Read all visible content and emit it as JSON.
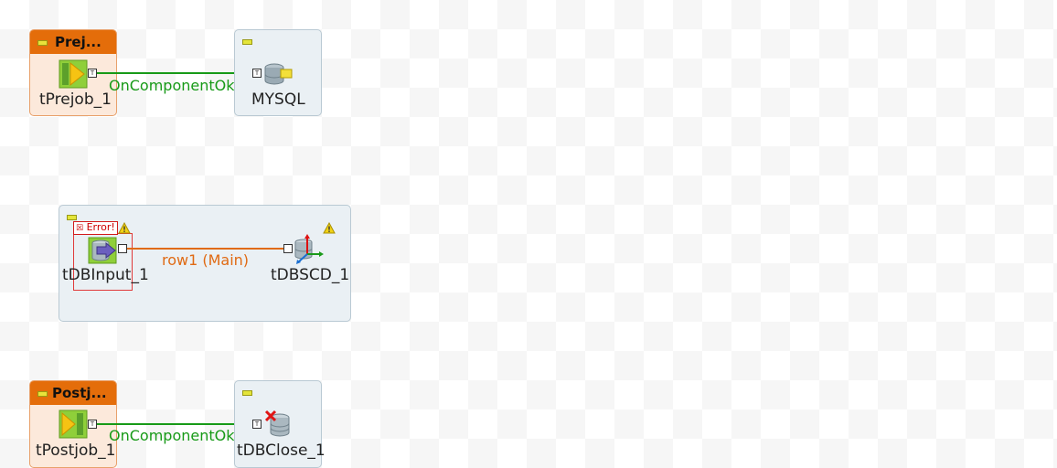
{
  "prejob": {
    "title": "Prej...",
    "component_label": "tPrejob_1",
    "target_label": "MYSQL",
    "link_label": "OnComponentOk",
    "connector_label": "T"
  },
  "subjob": {
    "error_label": "Error!",
    "source_label": "tDBInput_1",
    "target_label": "tDBSCD_1",
    "link_label": "row1 (Main)"
  },
  "postjob": {
    "title": "Postj...",
    "component_label": "tPostjob_1",
    "target_label": "tDBClose_1",
    "link_label": "OnComponentOk",
    "connector_label": "T"
  },
  "colors": {
    "trigger_link": "#179a17",
    "main_link": "#e06a13",
    "prejob_header": "#e46d0a"
  }
}
